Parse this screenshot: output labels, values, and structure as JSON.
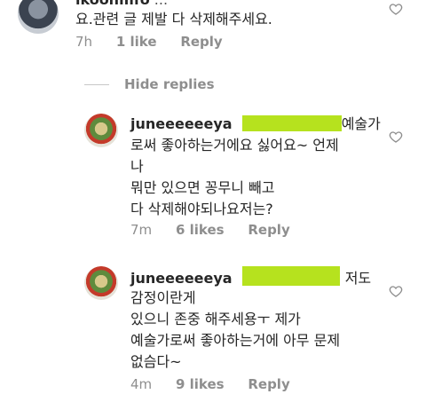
{
  "top_comment": {
    "username": "ikoohmfo",
    "line1_tail": "...",
    "line2": "요.관련 글 제발 다 삭제해주세요.",
    "time": "7h",
    "likes": "1 like",
    "reply": "Reply"
  },
  "hide_replies": "Hide replies",
  "replies": [
    {
      "username": "juneeeeeeya",
      "lines": [
        "예술가",
        "로써 좋아하는거에요 싫어요~ 언제",
        "나",
        "뭐만 있으면 꽁무니 빼고",
        "다 삭제해야되나요저는?"
      ],
      "time": "7m",
      "likes": "6 likes",
      "reply": "Reply"
    },
    {
      "username": "juneeeeeeya",
      "lines": [
        "저도",
        "감정이란게",
        "있으니 존중 해주세용ㅜ 제가",
        "예술가로써 좋아하는거에 아무 문제",
        "없슴다~"
      ],
      "time": "4m",
      "likes": "9 likes",
      "reply": "Reply"
    }
  ],
  "icons": {
    "heart": "heart-outline-icon",
    "avatar": "user-avatar"
  },
  "colors": {
    "redaction": "#b6e21e",
    "meta_text": "#8e8e8e",
    "text": "#262626"
  }
}
